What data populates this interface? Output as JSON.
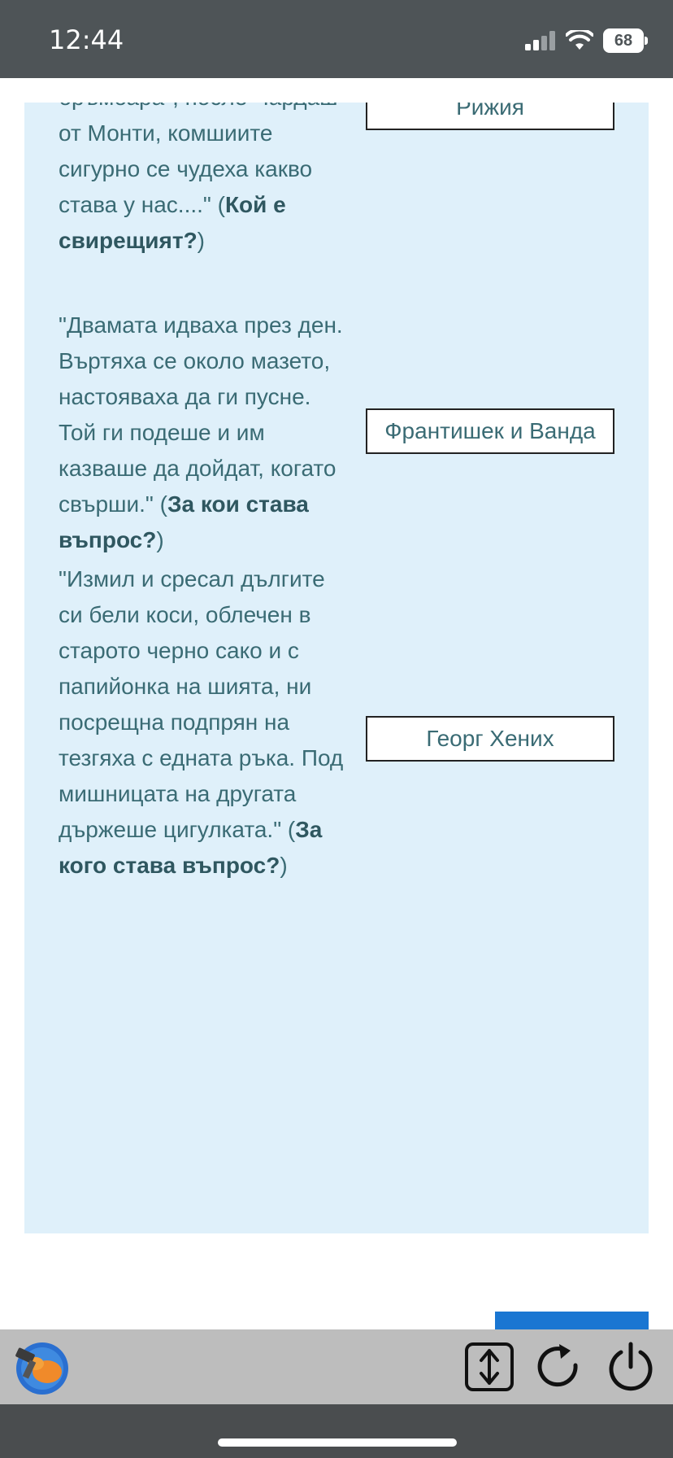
{
  "status_bar": {
    "time": "12:44",
    "battery": "68"
  },
  "entries": [
    {
      "text": "бръмбара\", после Чардаш\" от Монти, комшиите сигурно се чудеха какво става у нас....\" (",
      "question": "Кой е свирещият?",
      "close": ")"
    },
    {
      "text": "\"Двамата идваха през ден. Въртяха се около мазето, настояваха да ги пусне. Той ги подеше и им казваше да дойдат, когато свърши.\" (",
      "question": "За кои става въпрос?",
      "close": ")"
    },
    {
      "text": "\"Измил и сресал дългите си бели коси, облечен в старото черно сако и с папийонка на шията, ни посрещна подпрян на тезгяха с едната ръка. Под мишницата на другата държеше цигулката.\" (",
      "question": "За кого става въпрос?",
      "close": ")"
    }
  ],
  "answers": [
    "Рижия",
    "Франтишек и Ванда",
    "Георг Хених"
  ],
  "colors": {
    "panel_bg": "#dff0fa",
    "text": "#3a6b74",
    "accent_button": "#1a76d2",
    "toolbar_bg": "#bdbdbd"
  },
  "toolbar": {
    "icons": [
      "app-logo-icon",
      "scroll-toggle-icon",
      "reload-icon",
      "power-icon"
    ]
  }
}
